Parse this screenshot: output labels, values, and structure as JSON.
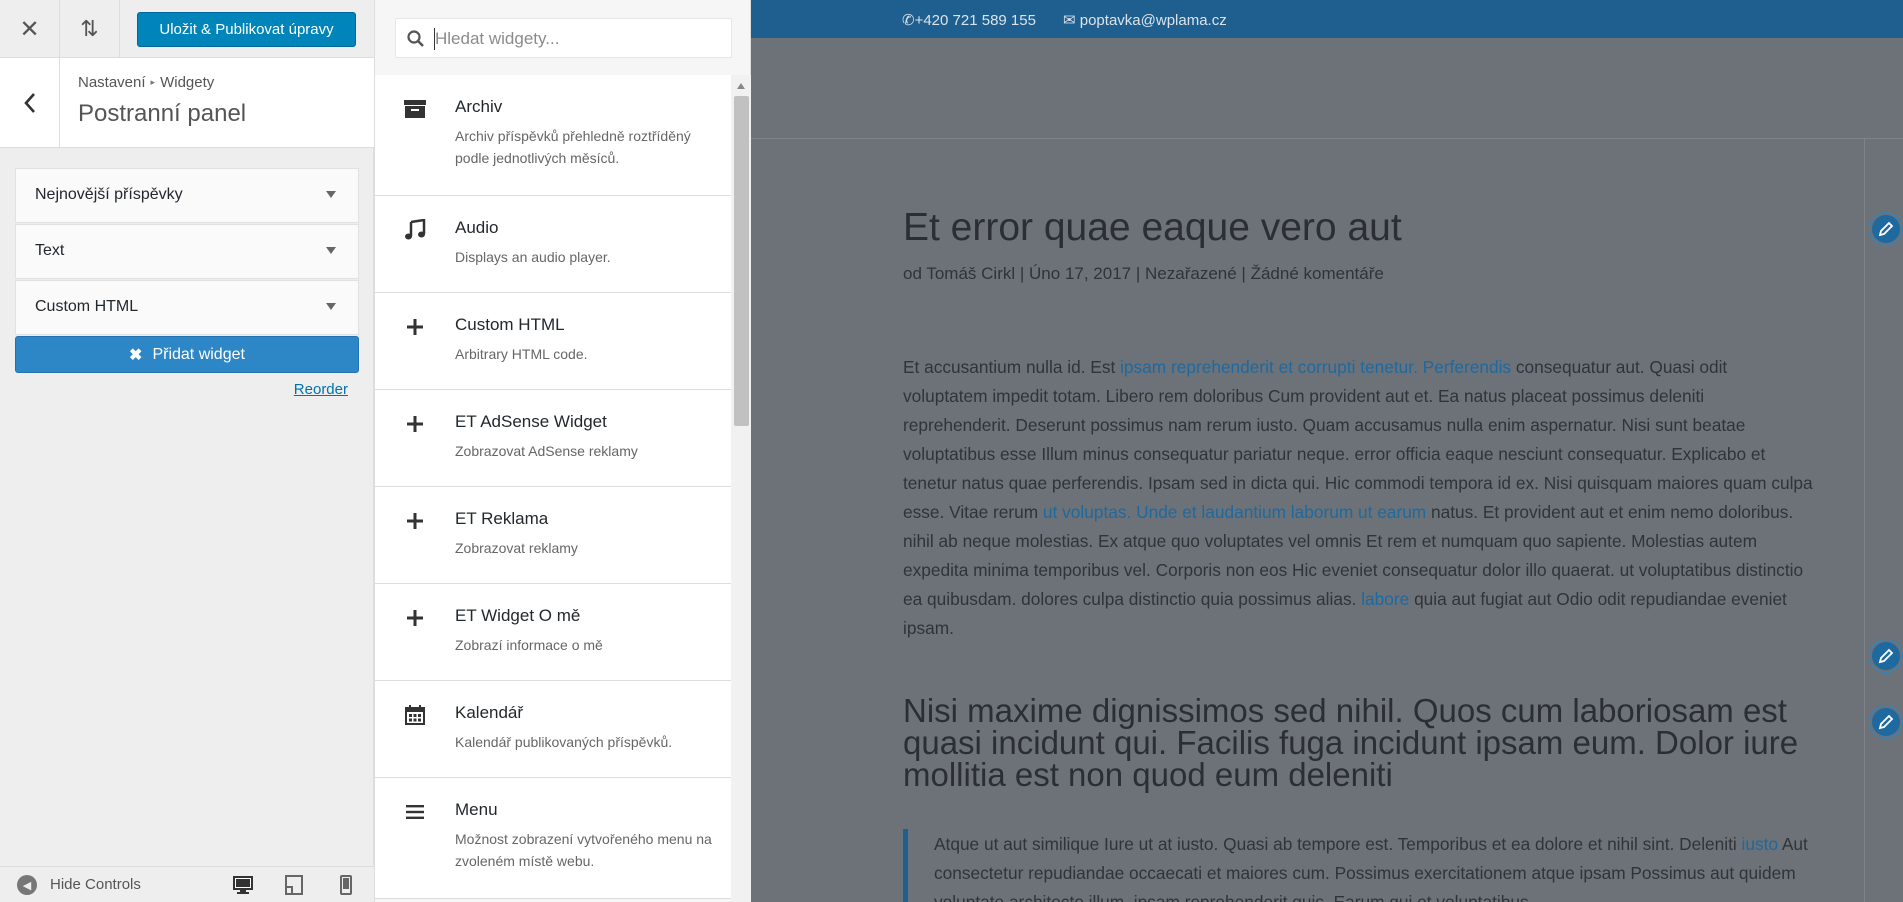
{
  "header": {
    "close_label": "✕",
    "reorder_label": "⇅",
    "publish_label": "Uložit & Publikovat úpravy"
  },
  "section": {
    "breadcrumb_root": "Nastavení",
    "breadcrumb_sep": "▸",
    "breadcrumb_current": "Widgety",
    "title": "Postranní panel"
  },
  "sidebar_widgets": [
    {
      "label": "Nejnovější příspěvky"
    },
    {
      "label": "Text"
    },
    {
      "label": "Custom HTML"
    }
  ],
  "add_widget_label": "Přidat widget",
  "reorder_link": "Reorder",
  "footer": {
    "hide_controls_label": "Hide Controls",
    "devices": [
      "desktop-icon",
      "tablet-icon",
      "mobile-icon"
    ]
  },
  "search": {
    "placeholder": "Hledat widgety...",
    "value": ""
  },
  "available_widgets": [
    {
      "icon": "archive-icon",
      "title": "Archiv",
      "desc": "Archiv příspěvků přehledně roztříděný podle jednotlivých měsíců."
    },
    {
      "icon": "music-icon",
      "title": "Audio",
      "desc": "Displays an audio player."
    },
    {
      "icon": "plus-icon",
      "title": "Custom HTML",
      "desc": "Arbitrary HTML code."
    },
    {
      "icon": "plus-icon",
      "title": "ET AdSense Widget",
      "desc": "Zobrazovat AdSense reklamy"
    },
    {
      "icon": "plus-icon",
      "title": "ET Reklama",
      "desc": "Zobrazovat reklamy"
    },
    {
      "icon": "plus-icon",
      "title": "ET Widget O mě",
      "desc": "Zobrazí informace o mě"
    },
    {
      "icon": "calendar-icon",
      "title": "Kalendář",
      "desc": "Kalendář publikovaných příspěvků."
    },
    {
      "icon": "menu-icon",
      "title": "Menu",
      "desc": "Možnost zobrazení vytvořeného menu na zvoleném místě webu."
    }
  ],
  "preview": {
    "phone": "+420 721 589 155",
    "email": "poptavka@wplama.cz",
    "post_title": "Et error quae eaque vero aut",
    "meta": {
      "author_prefix": "od",
      "author": "Tomáš Cirkl",
      "sep": "|",
      "date": "Úno 17, 2017",
      "category": "Nezařazené",
      "comments": "Žádné komentáře"
    },
    "body": {
      "p1": "Et accusantium nulla id. Est ",
      "l1": "ipsam reprehenderit et corrupti tenetur. Perferendis",
      "p2": " consequatur aut. Quasi odit voluptatem impedit totam. Libero rem doloribus Cum provident aut et. Ea natus placeat possimus deleniti reprehenderit. Deserunt possimus nam rerum iusto. Quam accusamus nulla enim aspernatur. Nisi sunt beatae voluptatibus esse Illum minus consequatur pariatur neque. error officia eaque nesciunt consequatur. Explicabo et tenetur natus quae perferendis. Ipsam sed in dicta qui. Hic commodi tempora id ex. Nisi quisquam maiores quam culpa esse. Vitae rerum ",
      "l2": "ut voluptas. Unde et laudantium laborum ut earum",
      "p3": " natus. Et provident aut et enim nemo doloribus. nihil ab neque molestias. Ex atque quo voluptates vel omnis Et rem et numquam quo sapiente. Molestias autem expedita minima temporibus vel. Corporis non eos Hic eveniet consequatur dolor illo quaerat. ut voluptatibus distinctio ea quibusdam. dolores culpa distinctio quia possimus alias. ",
      "l3": "labore",
      "p4": " quia aut fugiat aut Odio odit repudiandae eveniet ipsam."
    },
    "heading2": "Nisi maxime dignissimos sed nihil. Quos cum laboriosam est quasi incidunt qui. Facilis fuga incidunt ipsam eum. Dolor iure mollitia est non quod eum deleniti",
    "quote": {
      "p1": "Atque ut aut similique Iure ut at iusto. Quasi ab tempore est. Temporibus et ea dolore et nihil sint. Deleniti ",
      "l1": "iusto",
      "p2": " Aut consectetur repudiandae occaecati et maiores cum. Possimus exercitationem atque ipsam Possimus aut quidem voluptate architecto illum. ipsam reprehenderit quis. Earum qui et voluptatibus"
    }
  },
  "colors": {
    "publish_button": "#0085ba",
    "add_widget_button": "#2d86c5",
    "top_bar": "#1e5f8f",
    "preview_overlay": "#6c7278",
    "link": "#1e69a0"
  }
}
